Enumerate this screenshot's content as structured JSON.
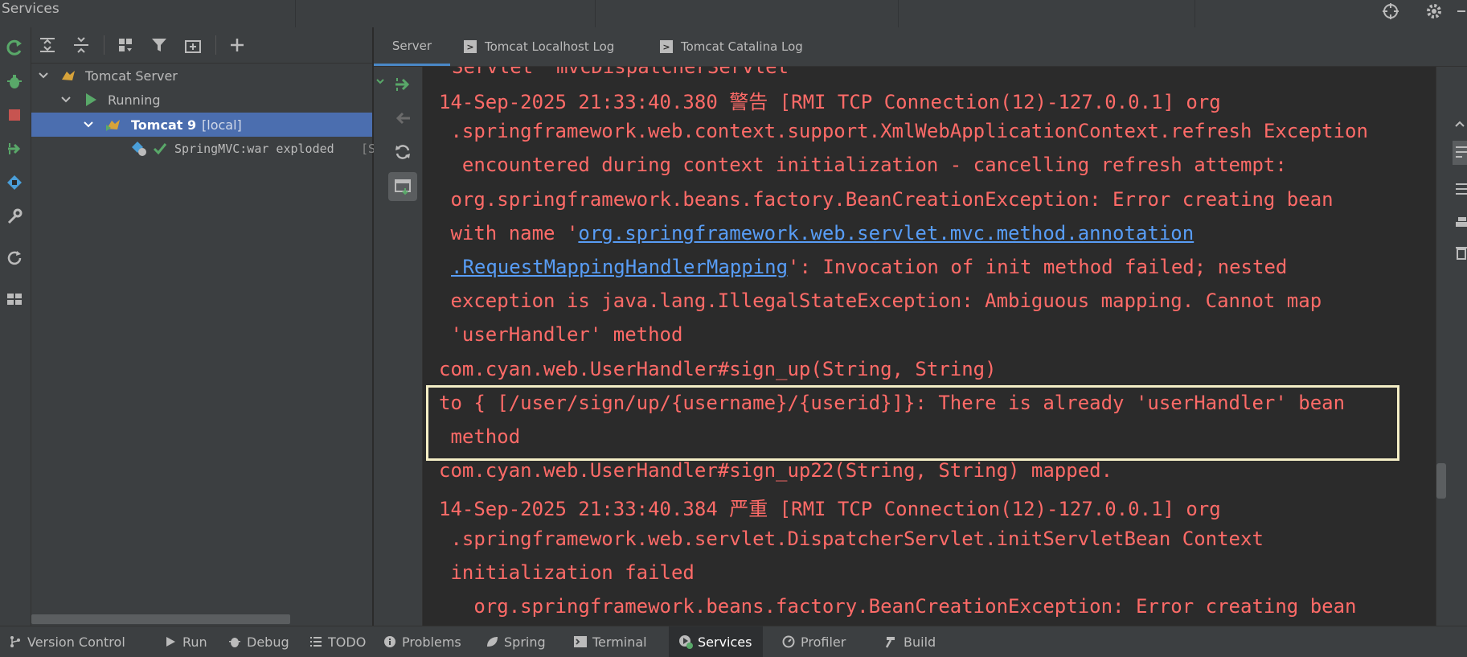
{
  "window": {
    "title": "Services"
  },
  "colors": {
    "accent": "#4b6eaf",
    "error_text": "#ff6b68",
    "link": "#589df6",
    "running": "#59a869",
    "highlight_box": "#f4eec6"
  },
  "tree": {
    "items": [
      {
        "label": "Tomcat Server"
      },
      {
        "label": "Running"
      },
      {
        "label": "Tomcat 9",
        "suffix": "[local]"
      },
      {
        "label": "SpringMVC:war exploded",
        "suffix": "[S"
      }
    ]
  },
  "tabs": [
    {
      "label": "Server"
    },
    {
      "label": "Tomcat Localhost Log"
    },
    {
      "label": "Tomcat Catalina Log"
    }
  ],
  "log": {
    "lines": [
      "Servlet  mvcDispatcherServlet",
      "14-Sep-2025 21:33:40.380 警告 [RMI TCP Connection(12)-127.0.0.1] org",
      " .springframework.web.context.support.XmlWebApplicationContext.refresh Exception",
      "  encountered during context initialization - cancelling refresh attempt:",
      " org.springframework.beans.factory.BeanCreationException: Error creating bean",
      " with name '",
      "': Invocation of init method failed; nested",
      " exception is java.lang.IllegalStateException: Ambiguous mapping. Cannot map",
      " 'userHandler' method",
      "com.cyan.web.UserHandler#sign_up(String, String)",
      "to { [/user/sign/up/{username}/{userid}]}: There is already 'userHandler' bean",
      " method",
      "com.cyan.web.UserHandler#sign_up22(String, String) mapped.",
      "14-Sep-2025 21:33:40.384 严重 [RMI TCP Connection(12)-127.0.0.1] org",
      " .springframework.web.servlet.DispatcherServlet.initServletBean Context",
      " initialization failed",
      "   org.springframework.beans.factory.BeanCreationException: Error creating bean"
    ],
    "link_part1": "org.springframework.web.servlet.mvc.method.annotation",
    "link_part2": ".RequestMappingHandlerMapping"
  },
  "bottom_tabs": [
    {
      "label": "Version Control",
      "icon": "branch-icon"
    },
    {
      "label": "Run",
      "icon": "play-icon"
    },
    {
      "label": "Debug",
      "icon": "bug-icon"
    },
    {
      "label": "TODO",
      "icon": "list-icon"
    },
    {
      "label": "Problems",
      "icon": "info-icon"
    },
    {
      "label": "Spring",
      "icon": "leaf-icon"
    },
    {
      "label": "Terminal",
      "icon": "terminal-icon"
    },
    {
      "label": "Services",
      "icon": "services-icon"
    },
    {
      "label": "Profiler",
      "icon": "profiler-icon"
    },
    {
      "label": "Build",
      "icon": "hammer-icon"
    }
  ]
}
